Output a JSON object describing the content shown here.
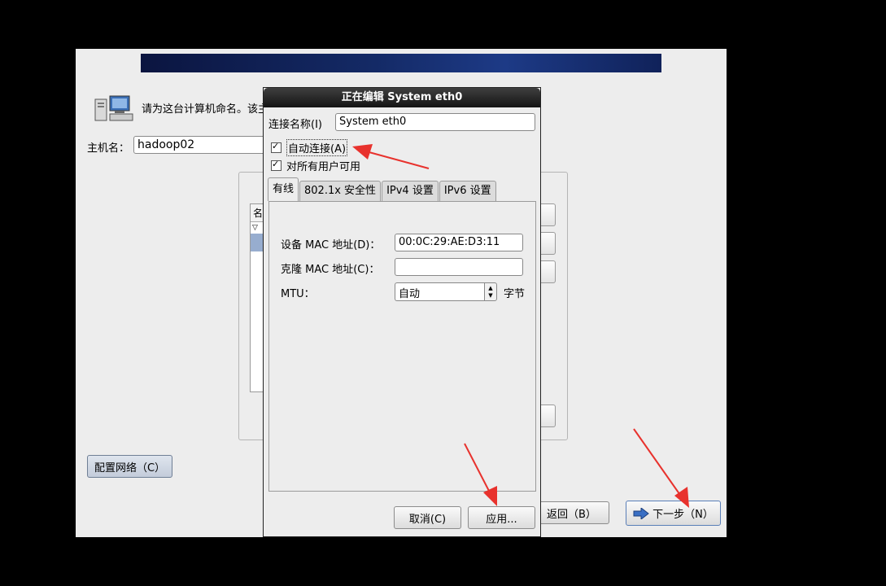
{
  "installer": {
    "intro_text": "请为这台计算机命名。该主",
    "host_label": "主机名：",
    "host_value": "hadoop02",
    "list_header": "名",
    "configure_network_label": "配置网络（C）",
    "back_label": "返回（B）",
    "next_label": "下一步（N）"
  },
  "dialog": {
    "title": "正在编辑 System eth0",
    "conn_name_label": "连接名称(I)",
    "conn_name_value": "System eth0",
    "auto_connect_label": "自动连接(A)",
    "auto_connect_checked": true,
    "all_users_label": "对所有用户可用",
    "all_users_checked": true,
    "tabs": [
      {
        "label": "有线",
        "active": true
      },
      {
        "label": "802.1x 安全性",
        "active": false
      },
      {
        "label": "IPv4 设置",
        "active": false
      },
      {
        "label": "IPv6 设置",
        "active": false
      }
    ],
    "mac_label": "设备 MAC 地址(D)：",
    "mac_value": "00:0C:29:AE:D3:11",
    "clone_mac_label": "克隆 MAC 地址(C)：",
    "clone_mac_value": "",
    "mtu_label": "MTU：",
    "mtu_value": "自动",
    "mtu_unit": "字节",
    "cancel_label": "取消(C)",
    "apply_label": "应用..."
  },
  "colors": {
    "annotation_arrow": "#e8322d",
    "banner": "#142a66",
    "selection": "#97adcf"
  },
  "icons": [
    "computer-network-icon",
    "next-arrow-icon",
    "spin-up-icon",
    "spin-down-icon"
  ]
}
